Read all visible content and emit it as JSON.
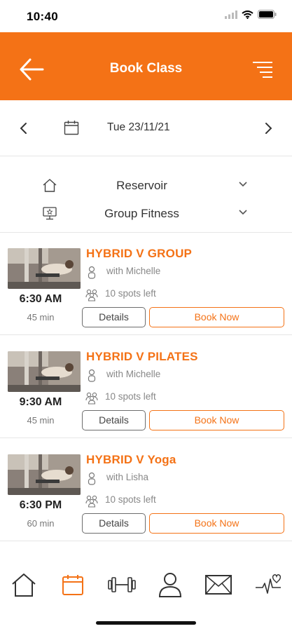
{
  "status_bar": {
    "time": "10:40"
  },
  "header": {
    "title": "Book Class"
  },
  "date_selector": {
    "date": "Tue 23/11/21"
  },
  "filters": [
    {
      "label": "Reservoir",
      "icon": "home-icon"
    },
    {
      "label": "Group Fitness",
      "icon": "monitor-icon"
    }
  ],
  "classes": [
    {
      "title": "HYBRID V GROUP",
      "instructor": "with Michelle",
      "spots": "10 spots left",
      "time": "6:30 AM",
      "duration": "45 min",
      "details_label": "Details",
      "book_label": "Book Now"
    },
    {
      "title": "HYBRID V PILATES",
      "instructor": "with Michelle",
      "spots": "10 spots left",
      "time": "9:30 AM",
      "duration": "45 min",
      "details_label": "Details",
      "book_label": "Book Now"
    },
    {
      "title": "HYBRID V Yoga",
      "instructor": "with Lisha",
      "spots": "10 spots left",
      "time": "6:30 PM",
      "duration": "60 min",
      "details_label": "Details",
      "book_label": "Book Now"
    }
  ],
  "tabbar": {
    "active": "calendar",
    "items": [
      "home-icon",
      "calendar-icon",
      "dumbbell-icon",
      "profile-icon",
      "mail-icon",
      "heartbeat-icon"
    ]
  },
  "colors": {
    "accent": "#f47216",
    "text": "#333333",
    "muted": "#888888",
    "divider": "#e6e6e6"
  }
}
